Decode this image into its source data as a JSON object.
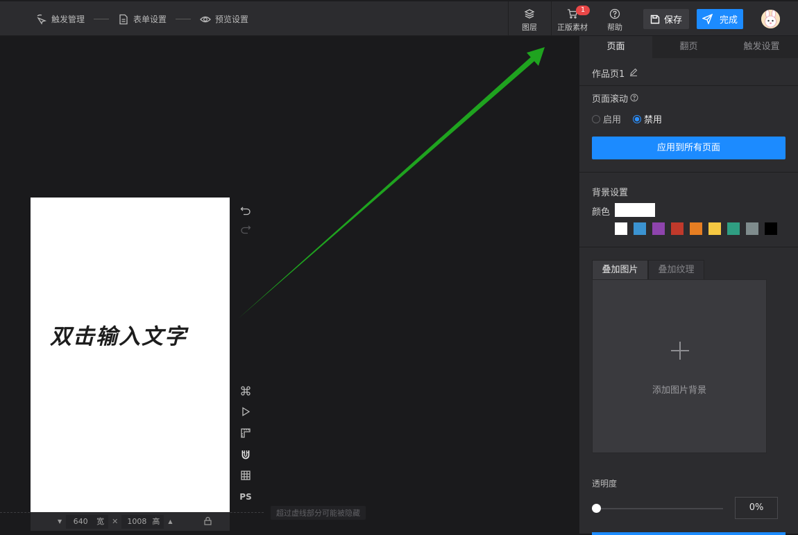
{
  "topbar": {
    "steps": [
      {
        "label": "触发管理",
        "icon": "cursor-click-icon"
      },
      {
        "label": "表单设置",
        "icon": "document-icon"
      },
      {
        "label": "预览设置",
        "icon": "eye-icon"
      }
    ],
    "tools": [
      {
        "label": "图层",
        "icon": "layers-icon"
      },
      {
        "label": "正版素材",
        "icon": "cart-icon",
        "badge": "1"
      },
      {
        "label": "帮助",
        "icon": "help-icon"
      }
    ],
    "save_label": "保存",
    "done_label": "完成"
  },
  "canvas": {
    "page_text": "双击输入文字",
    "width_value": "640",
    "width_unit": "宽",
    "times": "✕",
    "height_value": "1008",
    "height_unit": "高",
    "side_tools_ps": "PS",
    "hidden_hint": "超过虚线部分可能被隐藏"
  },
  "panel": {
    "tabs": [
      "页面",
      "翻页",
      "触发设置"
    ],
    "page_name": "作品页1",
    "scroll_label": "页面滚动",
    "radio_enable": "启用",
    "radio_disable": "禁用",
    "apply_all": "应用到所有页面",
    "bg_title": "背景设置",
    "color_label": "颜色",
    "swatches": [
      "#ffffff",
      "#3b93d1",
      "#8e44ad",
      "#c0392b",
      "#e67e22",
      "#f5c842",
      "#2f9e82",
      "#7f8c8d",
      "#000000"
    ],
    "bg_tabs": [
      "叠加图片",
      "叠加纹理"
    ],
    "add_bg": "添加图片背景",
    "opacity_label": "透明度",
    "opacity_value": "0%"
  },
  "colors": {
    "accent": "#1c8bff",
    "arrow": "#1fa31f",
    "badge": "#e94747"
  }
}
